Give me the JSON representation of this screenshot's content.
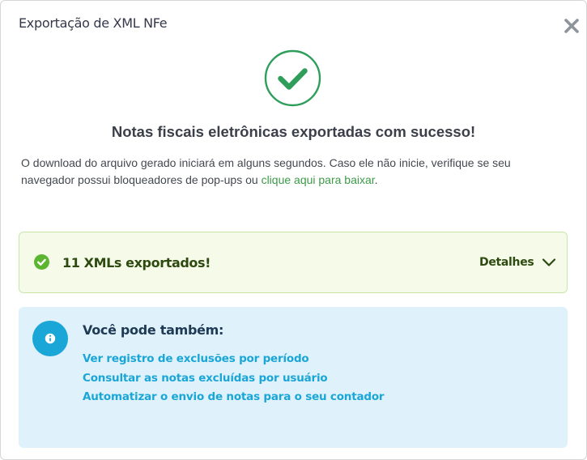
{
  "modal": {
    "title": "Exportação de XML NFe",
    "close_icon": "close-icon"
  },
  "status": {
    "icon": "check-circle-icon",
    "color": "#2f9e5b",
    "headline": "Notas fiscais eletrônicas exportadas com sucesso!",
    "message_before_link": "O download do arquivo gerado iniciará em alguns segundos. Caso ele não inicie, verifique se seu navegador possui bloqueadores de pop-ups ou ",
    "link_text": "clique aqui para baixar",
    "message_after_link": "."
  },
  "export_summary": {
    "icon": "check-circle-icon",
    "label": "11 XMLs exportados!",
    "details_label": "Detalhes",
    "details_icon": "chevron-down-icon",
    "background": "#f5fbe8",
    "border": "#c9e6a9"
  },
  "tips": {
    "icon": "info-icon",
    "heading": "Você pode também:",
    "links": [
      "Ver registro de exclusões por período",
      "Consultar as notas excluídas por usuário",
      "Automatizar o envio de notas para o seu contador"
    ],
    "background": "#dff1fa",
    "link_color": "#1aa6d6"
  }
}
